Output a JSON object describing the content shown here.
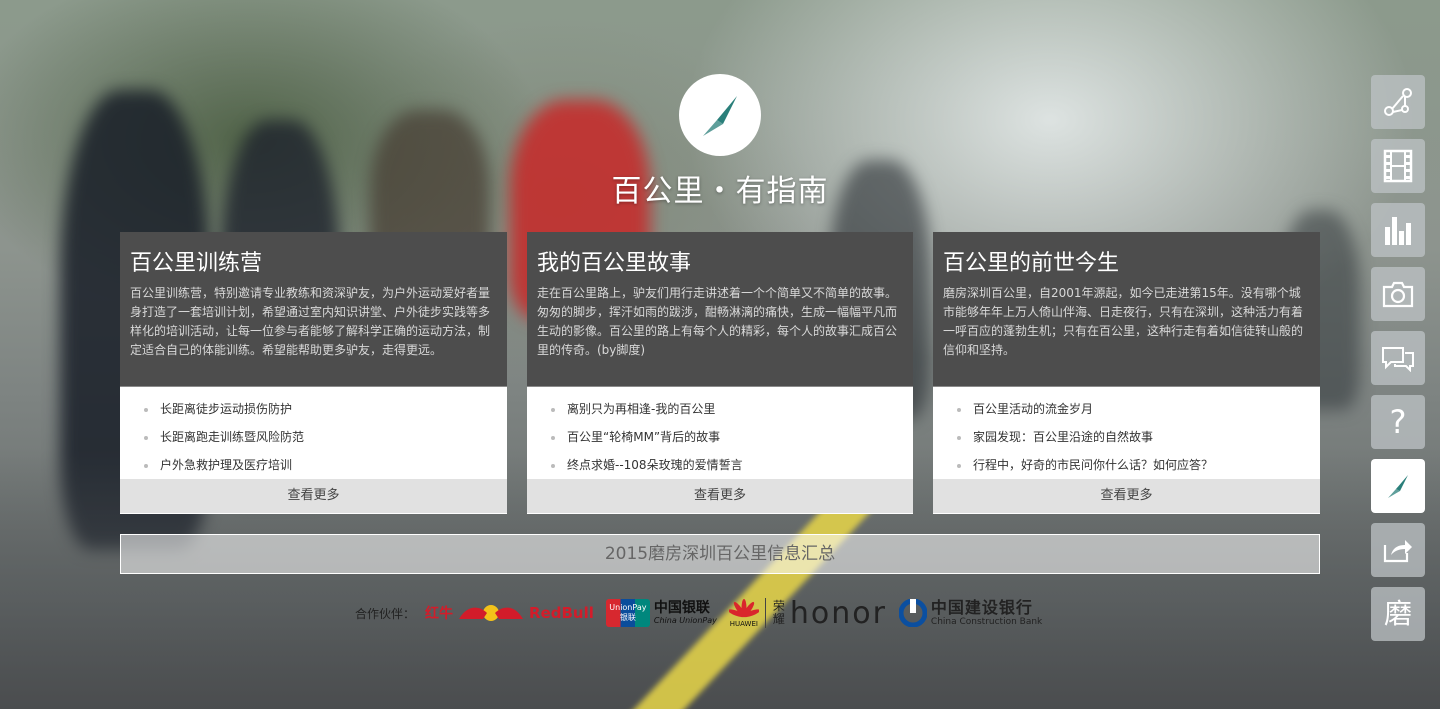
{
  "site": {
    "title": "百公里・有指南"
  },
  "cards": [
    {
      "title": "百公里训练营",
      "description": "百公里训练营，特别邀请专业教练和资深驴友，为户外运动爱好者量身打造了一套培训计划，希望通过室内知识讲堂、户外徒步实践等多样化的培训活动，让每一位参与者能够了解科学正确的运动方法，制定适合自己的体能训练。希望能帮助更多驴友，走得更远。",
      "items": [
        "长距离徒步运动损伤防护",
        "长距离跑走训练暨风险防范",
        "户外急救护理及医疗培训"
      ],
      "more": "查看更多"
    },
    {
      "title": "我的百公里故事",
      "description": "走在百公里路上，驴友们用行走讲述着一个个简单又不简单的故事。匆匆的脚步，挥汗如雨的跋涉，酣畅淋漓的痛快，生成一幅幅平凡而生动的影像。百公里的路上有每个人的精彩，每个人的故事汇成百公里的传奇。(by脚度)",
      "items": [
        "离别只为再相逢-我的百公里",
        "百公里“轮椅MM”背后的故事",
        "终点求婚--108朵玫瑰的爱情誓言"
      ],
      "more": "查看更多"
    },
    {
      "title": "百公里的前世今生",
      "description": "磨房深圳百公里，自2001年源起，如今已走进第15年。没有哪个城市能够年年上万人倚山伴海、日走夜行，只有在深圳，这种活力有着一呼百应的蓬勃生机；只有在百公里，这种行走有着如信徒转山般的信仰和坚持。",
      "items": [
        "百公里活动的流金岁月",
        "家园发现：百公里沿途的自然故事",
        "行程中，好奇的市民问你什么话？如何应答？"
      ],
      "more": "查看更多"
    }
  ],
  "summary": {
    "label": "2015磨房深圳百公里信息汇总"
  },
  "partners": {
    "label": "合作伙伴：",
    "redbull_cn": "红牛",
    "redbull_en": "RedBull",
    "unionpay_badge_top": "UnionPay",
    "unionpay_badge_bottom": "银联",
    "unionpay_cn": "中国银联",
    "unionpay_en": "China UnionPay",
    "huawei": "HUAWEI",
    "honor_cn": "荣耀",
    "honor_en": "honor",
    "ccb_cn": "中国建设银行",
    "ccb_en": "China Construction Bank"
  },
  "toolbar": {
    "items": [
      {
        "name": "route-map-icon"
      },
      {
        "name": "film-icon"
      },
      {
        "name": "bar-chart-icon"
      },
      {
        "name": "camera-icon"
      },
      {
        "name": "chat-icon"
      },
      {
        "name": "help-icon",
        "glyph": "?"
      },
      {
        "name": "compass-icon",
        "active": true
      },
      {
        "name": "share-icon"
      },
      {
        "name": "mofang-icon",
        "glyph": "磨"
      }
    ]
  },
  "colors": {
    "accent": "#2a7f7a",
    "card_head": "#343434",
    "card_footer": "#e1e1e1",
    "redbull": "#d31c2a"
  }
}
